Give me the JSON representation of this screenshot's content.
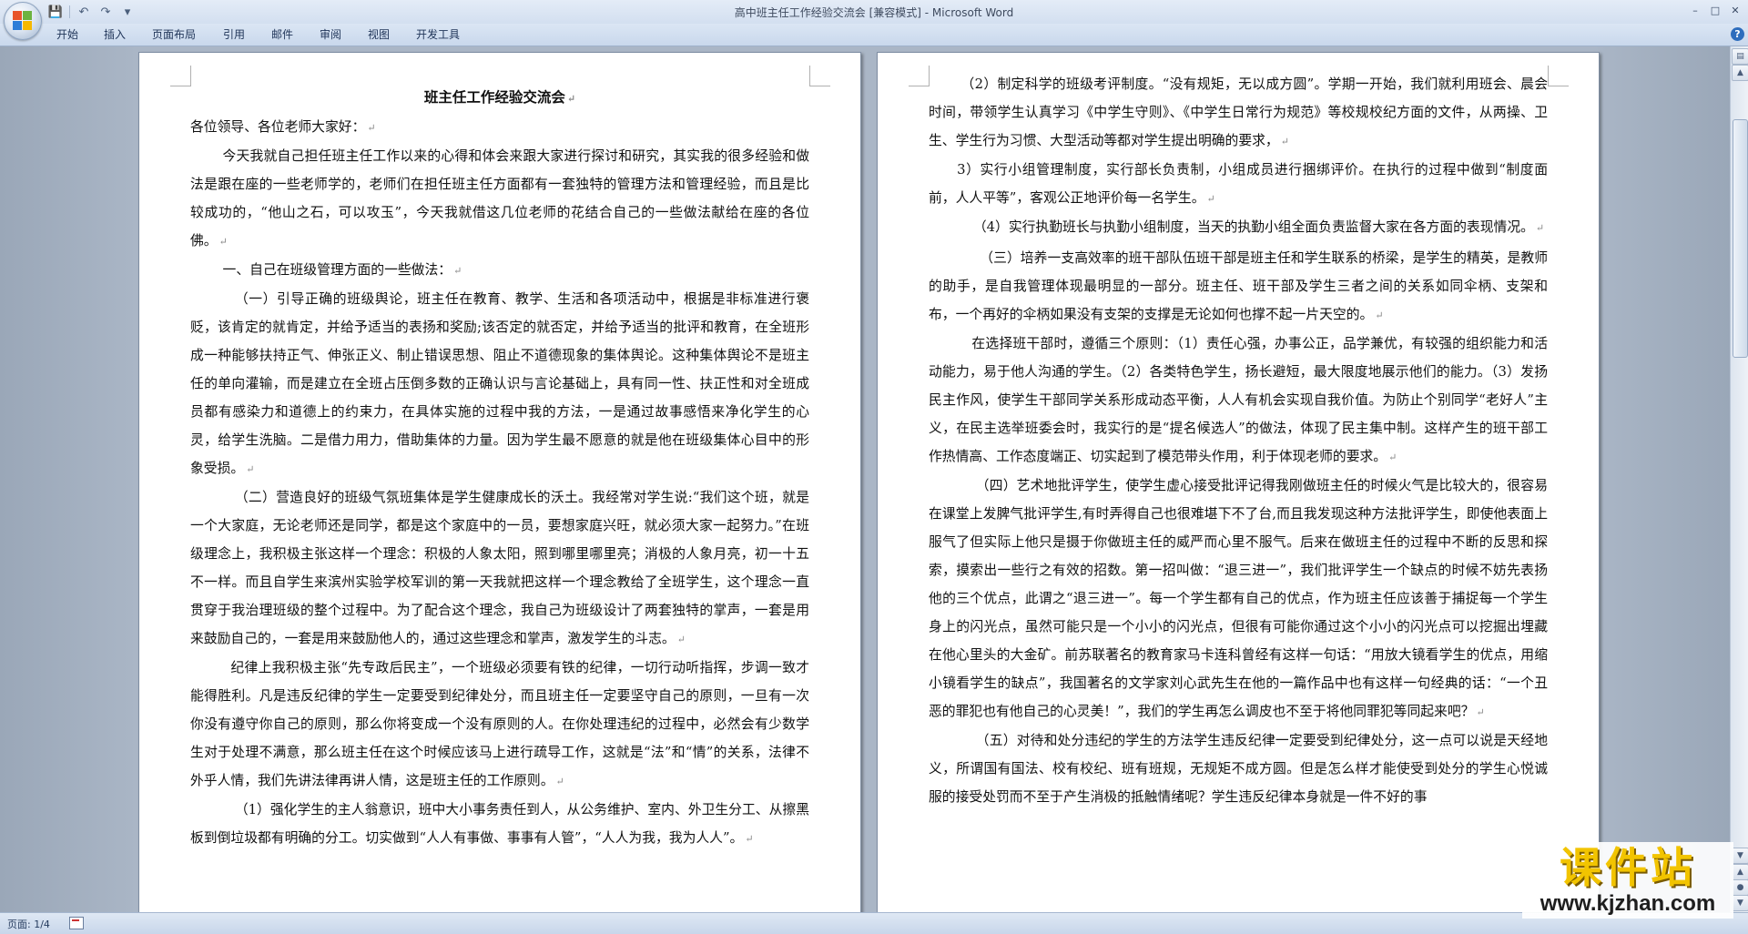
{
  "window": {
    "title": "高中班主任工作经验交流会 [兼容模式] - Microsoft Word"
  },
  "quick_access": {
    "icons": [
      "save-icon",
      "undo-icon",
      "redo-icon",
      "customize-icon"
    ],
    "save_glyph": "💾",
    "undo_glyph": "↶",
    "redo_glyph": "↷",
    "more_glyph": "▾"
  },
  "window_controls": {
    "minimize": "–",
    "restore": "□",
    "close": "✕"
  },
  "ribbon": {
    "tabs": [
      "开始",
      "插入",
      "页面布局",
      "引用",
      "邮件",
      "审阅",
      "视图",
      "开发工具"
    ],
    "help": "?"
  },
  "page1": {
    "title": "班主任工作经验交流会",
    "paragraphs": [
      "各位领导、各位老师大家好：",
      "今天我就自己担任班主任工作以来的心得和体会来跟大家进行探讨和研究，其实我的很多经验和做法是跟在座的一些老师学的，老师们在担任班主任方面都有一套独特的管理方法和管理经验，而且是比较成功的，“他山之石，可以攻玉”，今天我就借这几位老师的花结合自己的一些做法献给在座的各位佛。",
      "一、自己在班级管理方面的一些做法：",
      "（一）引导正确的班级舆论，班主任在教育、教学、生活和各项活动中，根据是非标准进行褒贬，该肯定的就肯定，并给予适当的表扬和奖励;该否定的就否定，并给予适当的批评和教育，在全班形成一种能够扶持正气、伸张正义、制止错误思想、阻止不道德现象的集体舆论。这种集体舆论不是班主任的单向灌输，而是建立在全班占压倒多数的正确认识与言论基础上，具有同一性、扶正性和对全班成员都有感染力和道德上的约束力，在具体实施的过程中我的方法，一是通过故事感悟来净化学生的心灵，给学生洗脑。二是借力用力，借助集体的力量。因为学生最不愿意的就是他在班级集体心目中的形象受损。",
      "（二）营造良好的班级气氛班集体是学生健康成长的沃土。我经常对学生说:“我们这个班，就是一个大家庭，无论老师还是同学，都是这个家庭中的一员，要想家庭兴旺，就必须大家一起努力。”在班级理念上，我积极主张这样一个理念：积极的人象太阳，照到哪里哪里亮；消极的人象月亮，初一十五不一样。而且自学生来滨州实验学校军训的第一天我就把这样一个理念教给了全班学生，这个理念一直贯穿于我治理班级的整个过程中。为了配合这个理念，我自己为班级设计了两套独特的掌声，一套是用来鼓励自己的，一套是用来鼓励他人的，通过这些理念和掌声，激发学生的斗志。",
      "纪律上我积极主张“先专政后民主”，一个班级必须要有铁的纪律，一切行动听指挥，步调一致才能得胜利。凡是违反纪律的学生一定要受到纪律处分，而且班主任一定要坚守自己的原则，一旦有一次你没有遵守你自己的原则，那么你将变成一个没有原则的人。在你处理违纪的过程中，必然会有少数学生对于处理不满意，那么班主任在这个时候应该马上进行疏导工作，这就是“法”和“情”的关系，法律不外乎人情，我们先讲法律再讲人情，这是班主任的工作原则。",
      "（1）强化学生的主人翁意识，班中大小事务责任到人，从公务维护、室内、外卫生分工、从擦黑板到倒垃圾都有明确的分工。切实做到“人人有事做、事事有人管”，“人人为我，我为人人”。"
    ]
  },
  "page2": {
    "paragraphs": [
      "（2）制定科学的班级考评制度。“没有规矩，无以成方圆”。学期一开始，我们就利用班会、晨会时间，带领学生认真学习《中学生守则》、《中学生日常行为规范》等校规校纪方面的文件，从两操、卫生、学生行为习惯、大型活动等都对学生提出明确的要求，",
      "3）实行小组管理制度，实行部长负责制，小组成员进行捆绑评价。在执行的过程中做到“制度面前，人人平等”，客观公正地评价每一名学生。",
      "（4）实行执勤班长与执勤小组制度，当天的执勤小组全面负责监督大家在各方面的表现情况。",
      "（三）培养一支高效率的班干部队伍班干部是班主任和学生联系的桥梁，是学生的精英，是教师的助手，是自我管理体现最明显的一部分。班主任、班干部及学生三者之间的关系如同伞柄、支架和布，一个再好的伞柄如果没有支架的支撑是无论如何也撑不起一片天空的。",
      "在选择班干部时，遵循三个原则：（1）责任心强，办事公正，品学兼优，有较强的组织能力和活动能力，易于他人沟通的学生。（2）各类特色学生，扬长避短，最大限度地展示他们的能力。（3）发扬民主作风，使学生干部同学关系形成动态平衡，人人有机会实现自我价值。为防止个别同学“老好人”主义，在民主选举班委会时，我实行的是“提名候选人”的做法，体现了民主集中制。这样产生的班干部工作热情高、工作态度端正、切实起到了模范带头作用，利于体现老师的要求。",
      "（四）艺术地批评学生，使学生虚心接受批评记得我刚做班主任的时候火气是比较大的，很容易在课堂上发脾气批评学生,有时弄得自己也很难堪下不了台,而且我发现这种方法批评学生，即使他表面上服气了但实际上他只是摄于你做班主任的威严而心里不服气。后来在做班主任的过程中不断的反思和探索，摸索出一些行之有效的招数。第一招叫做：“退三进一”，我们批评学生一个缺点的时候不妨先表扬他的三个优点，此谓之“退三进一”。每一个学生都有自己的优点，作为班主任应该善于捕捉每一个学生身上的闪光点，虽然可能只是一个小小的闪光点，但很有可能你通过这个小小的闪光点可以挖掘出埋藏在他心里头的大金矿。前苏联著名的教育家马卡连科曾经有这样一句话：“用放大镜看学生的优点，用缩小镜看学生的缺点”，我国著名的文学家刘心武先生在他的一篇作品中也有这样一句经典的话：“一个丑恶的罪犯也有他自己的心灵美！”，我们的学生再怎么调皮也不至于将他同罪犯等同起来吧？",
      "（五）对待和处分违纪的学生的方法学生违反纪律一定要受到纪律处分，这一点可以说是天经地义，所谓国有国法、校有校纪、班有班规，无规矩不成方圆。但是怎么样才能使受到处分的学生心悦诚服的接受处罚而不至于产生消极的抵触情绪呢？学生违反纪律本身就是一件不好的事"
    ]
  },
  "paragraph_mark": "↵",
  "statusbar": {
    "page_info": "页面: 1/4"
  },
  "watermark": {
    "text": "课件站",
    "url": "www.kjzhan.com"
  }
}
